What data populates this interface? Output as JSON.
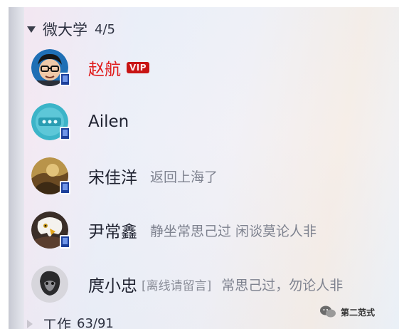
{
  "group": {
    "name": "微大学",
    "count": "4/5"
  },
  "contacts": [
    {
      "name": "赵航",
      "vip": "VIP",
      "status": ""
    },
    {
      "name": "Ailen",
      "status": ""
    },
    {
      "name": "宋佳洋",
      "status": "返回上海了"
    },
    {
      "name": "尹常鑫",
      "status": "静坐常思己过 闲谈莫论人非"
    },
    {
      "name": "庹小忠",
      "offline_tag": "[离线请留言]",
      "status": "常思己过，勿论人非"
    }
  ],
  "group2": {
    "name": "工作",
    "count": "63/91"
  },
  "watermark": {
    "text": "第二范式"
  },
  "icons": {
    "expand": "triangle-down-icon",
    "collapsed": "triangle-right-icon",
    "mobile": "mobile-online-icon",
    "watermark": "wechat-logo-icon"
  },
  "colors": {
    "vip_name": "#e01b1b",
    "vip_badge": "#c81414",
    "mobile_badge": "#1c3f9a"
  }
}
